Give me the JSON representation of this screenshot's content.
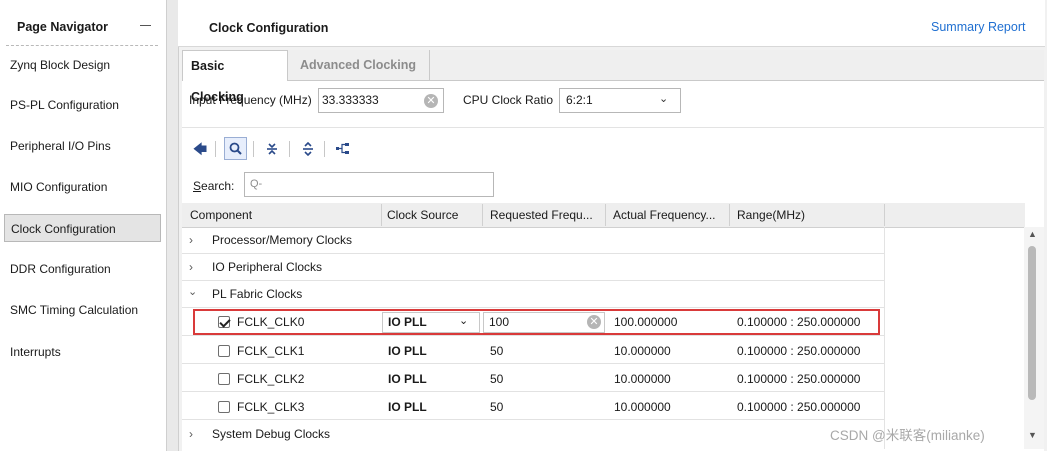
{
  "navigator": {
    "title": "Page Navigator",
    "items": [
      {
        "label": "Zynq Block Design"
      },
      {
        "label": "PS-PL Configuration"
      },
      {
        "label": "Peripheral I/O Pins"
      },
      {
        "label": "MIO Configuration"
      },
      {
        "label": "Clock Configuration",
        "selected": true
      },
      {
        "label": "DDR Configuration"
      },
      {
        "label": "SMC Timing Calculation"
      },
      {
        "label": "Interrupts"
      }
    ]
  },
  "main": {
    "title": "Clock Configuration",
    "summary_link": "Summary Report",
    "tabs": [
      {
        "label": "Basic Clocking",
        "active": true
      },
      {
        "label": "Advanced Clocking",
        "active": false
      }
    ],
    "input_frequency": {
      "label": "Input Frequency (MHz)",
      "value": "33.333333"
    },
    "cpu_clock_ratio": {
      "label": "CPU Clock Ratio",
      "value": "6:2:1"
    },
    "search": {
      "label_prefix": "S",
      "label_rest": "earch:",
      "placeholder": "Q-"
    },
    "table": {
      "columns": [
        "Component",
        "Clock Source",
        "Requested Frequ...",
        "Actual Frequency...",
        "Range(MHz)"
      ],
      "groups": [
        {
          "label": "Processor/Memory Clocks",
          "expanded": false
        },
        {
          "label": "IO Peripheral Clocks",
          "expanded": false
        },
        {
          "label": "PL Fabric Clocks",
          "expanded": true
        },
        {
          "label": "System Debug Clocks",
          "expanded": false
        }
      ],
      "clocks": [
        {
          "name": "FCLK_CLK0",
          "checked": true,
          "source": "IO PLL",
          "requested": "100",
          "actual": "100.000000",
          "range": "0.100000 : 250.000000"
        },
        {
          "name": "FCLK_CLK1",
          "checked": false,
          "source": "IO PLL",
          "requested": "50",
          "actual": "10.000000",
          "range": "0.100000 : 250.000000"
        },
        {
          "name": "FCLK_CLK2",
          "checked": false,
          "source": "IO PLL",
          "requested": "50",
          "actual": "10.000000",
          "range": "0.100000 : 250.000000"
        },
        {
          "name": "FCLK_CLK3",
          "checked": false,
          "source": "IO PLL",
          "requested": "50",
          "actual": "10.000000",
          "range": "0.100000 : 250.000000"
        }
      ]
    }
  },
  "watermark": "CSDN @米联客(milianke)",
  "colors": {
    "link": "#1f6fd1",
    "highlight": "#d93a3a"
  }
}
